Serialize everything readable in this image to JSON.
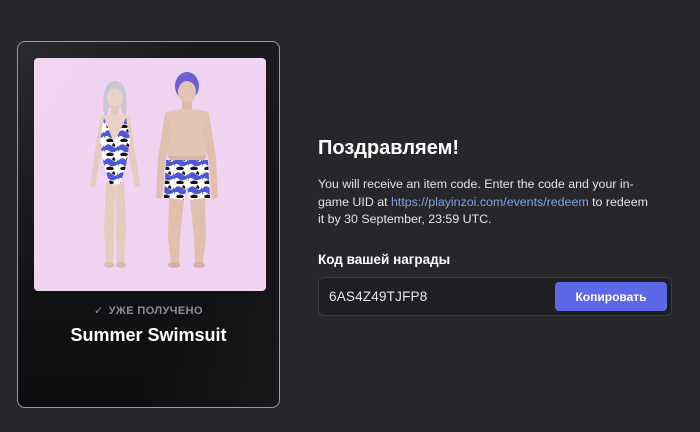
{
  "card": {
    "status_icon": "check-icon",
    "status_text": "УЖЕ ПОЛУЧЕНО",
    "item_name": "Summer Swimsuit"
  },
  "content": {
    "title": "Поздравляем!",
    "description_before_link": "You will receive an item code. Enter the code and your in-game UID at ",
    "link_text": "https://playinzoi.com/events/redeem",
    "description_after_link": " to redeem it by 30 September, 23:59 UTC.",
    "code_label": "Код вашей награды",
    "code_value": "6AS4Z49TJFP8",
    "copy_button_label": "Копировать"
  },
  "colors": {
    "background": "#27272b",
    "preview_background": "#f1d3f2",
    "accent_button": "#5b68e8",
    "link": "#7ea3e6",
    "muted_text": "#8e8e96"
  }
}
